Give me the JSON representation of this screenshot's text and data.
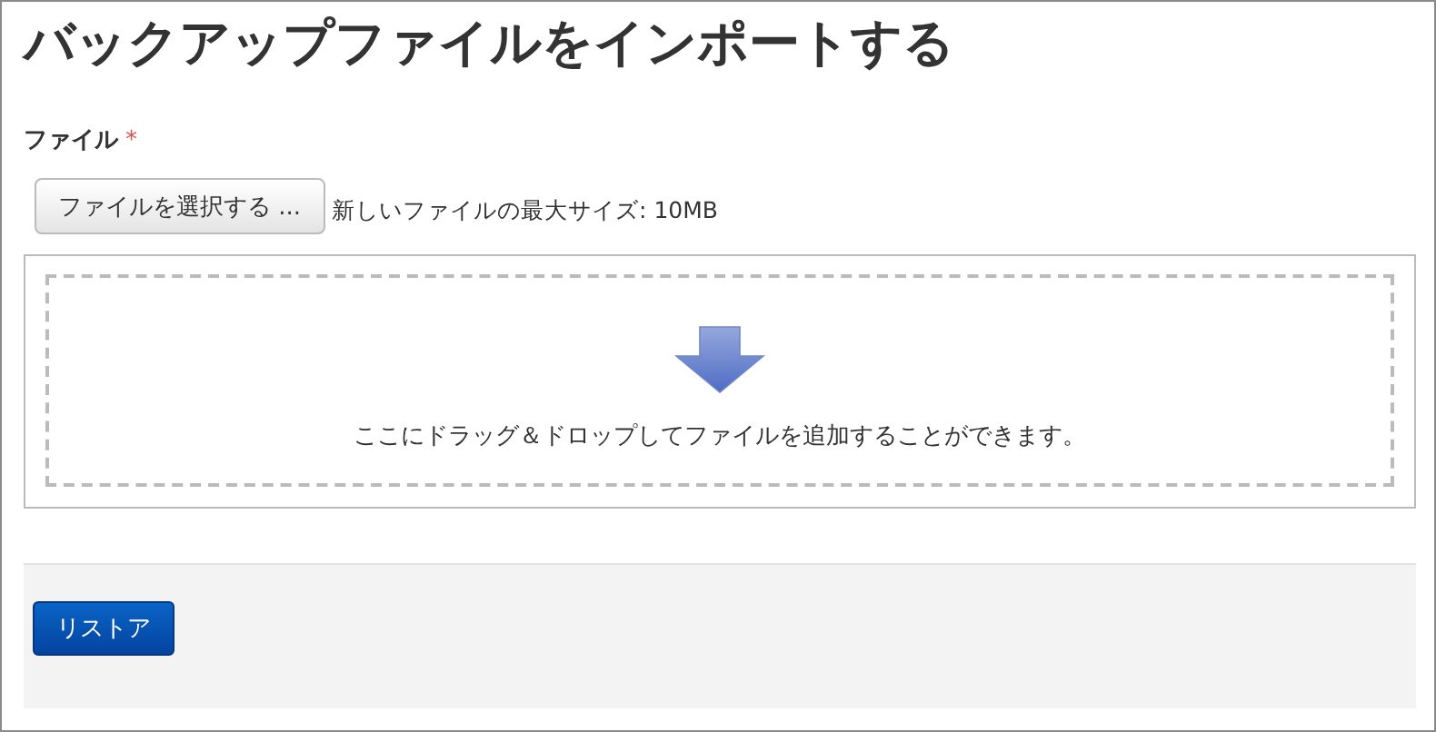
{
  "title": "バックアップファイルをインポートする",
  "file_field": {
    "label": "ファイル",
    "required_mark": "*",
    "button": "ファイルを選択する ...",
    "max_size": "新しいファイルの最大サイズ: 10MB",
    "drop_hint": "ここにドラッグ＆ドロップしてファイルを追加することができます。"
  },
  "footer": {
    "button": "リストア"
  }
}
